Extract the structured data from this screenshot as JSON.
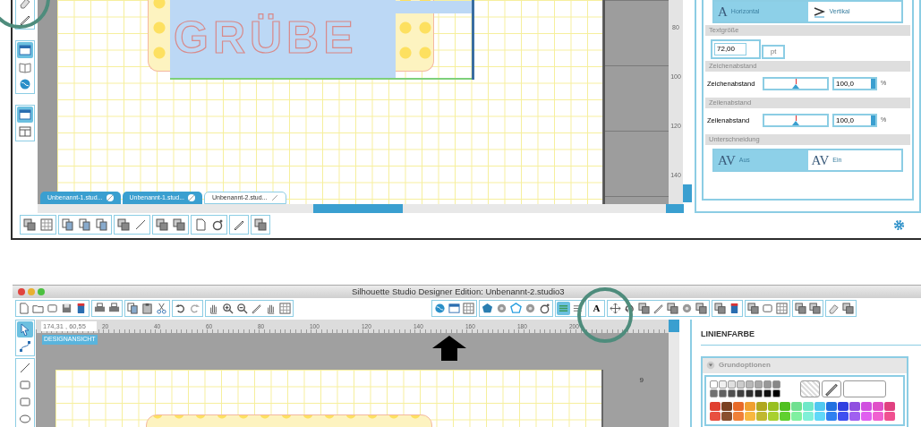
{
  "top_window": {
    "left_tools": [
      [
        {
          "selected": false
        },
        {
          "selected": false
        }
      ],
      [
        {
          "selected": true
        },
        {
          "selected": false
        },
        {
          "selected": false
        }
      ],
      [
        {
          "selected": true
        },
        {
          "selected": false
        }
      ]
    ],
    "canvas": {
      "design_text": "GRÜBE",
      "vertical_ruler": [
        "80",
        "100",
        "120",
        "140"
      ]
    },
    "document_tabs": [
      {
        "label": "Unbenannt-1.stud...",
        "selected": false
      },
      {
        "label": "Unbenannt-1.stud...",
        "selected": false
      },
      {
        "label": "Unbenannt-2.stud...",
        "selected": true
      }
    ],
    "text_panel": {
      "direction": [
        {
          "glyph": "A",
          "label": "Horizontal",
          "selected": true
        },
        {
          "label": "Vertikal",
          "selected": false
        }
      ],
      "text_size": {
        "heading": "Textgröße",
        "value": "72,00",
        "unit": "pt"
      },
      "spacing": [
        {
          "heading": "Zeichenabstand",
          "label": "Zeichenabstand",
          "level": 0.5,
          "value": "100,0",
          "unit": "%"
        },
        {
          "heading": "Zeilenabstand",
          "label": "Zeilenabstand",
          "level": 0.5,
          "value": "100,0",
          "unit": "%"
        }
      ],
      "kerning": {
        "heading": "Unterschneidung",
        "options": [
          {
            "glyph": "AV",
            "label": "Aus",
            "selected": true
          },
          {
            "glyph": "AV",
            "label": "Ein",
            "selected": false
          }
        ]
      }
    }
  },
  "bottom_window": {
    "title": "Silhouette Studio Designer Edition: Unbenannt-2.studio3",
    "toolbar": [
      {
        "kind": "icons",
        "items": [
          {
            "selected": false
          },
          {
            "selected": false
          },
          {
            "selected": false
          },
          {
            "selected": false
          },
          {
            "selected": false
          }
        ]
      },
      {
        "kind": "icons",
        "items": [
          {
            "selected": false
          },
          {
            "selected": false
          }
        ]
      },
      {
        "kind": "icons",
        "items": [
          {
            "selected": false
          },
          {
            "selected": false
          },
          {
            "selected": false
          }
        ]
      },
      {
        "kind": "icons",
        "items": [
          {
            "selected": false
          },
          {
            "selected": false
          }
        ]
      },
      {
        "kind": "icons",
        "items": [
          {
            "selected": false
          },
          {
            "selected": false
          },
          {
            "selected": false
          },
          {
            "selected": false
          },
          {
            "selected": false
          },
          {
            "selected": false
          }
        ]
      },
      {
        "kind": "spacer"
      },
      {
        "kind": "icons",
        "items": [
          {
            "selected": false
          },
          {
            "selected": false
          },
          {
            "selected": false
          }
        ]
      },
      {
        "kind": "icons",
        "items": [
          {
            "selected": false
          },
          {
            "selected": false
          },
          {
            "selected": false
          },
          {
            "selected": false
          },
          {
            "selected": false
          }
        ]
      },
      {
        "kind": "icons",
        "items": [
          {
            "selected": true
          },
          {
            "selected": false
          }
        ]
      },
      {
        "kind": "glyph",
        "glyph": "A",
        "selected": false
      },
      {
        "kind": "icons",
        "items": [
          {
            "selected": false
          },
          {
            "selected": false
          },
          {
            "selected": false
          },
          {
            "selected": false
          },
          {
            "selected": false
          },
          {
            "selected": false
          },
          {
            "selected": false
          }
        ]
      },
      {
        "kind": "icons",
        "items": [
          {
            "selected": false
          },
          {
            "selected": false
          }
        ]
      },
      {
        "kind": "icons",
        "items": [
          {
            "selected": false
          },
          {
            "selected": false
          },
          {
            "selected": false
          }
        ]
      },
      {
        "kind": "icons",
        "items": [
          {
            "selected": false
          },
          {
            "selected": false
          }
        ]
      },
      {
        "kind": "icons",
        "items": [
          {
            "selected": false
          },
          {
            "selected": false
          }
        ]
      }
    ],
    "left_tools": [
      [
        {
          "selected": true
        },
        {
          "selected": false
        }
      ],
      [
        {
          "selected": false
        },
        {
          "selected": false
        },
        {
          "selected": false
        },
        {
          "selected": false
        }
      ]
    ],
    "ruler": {
      "coordinates": "174,31 , 60,55",
      "labels": [
        "20",
        "40",
        "60",
        "80",
        "100",
        "120",
        "140",
        "160",
        "180",
        "200"
      ]
    },
    "view_label": "DESIGNANSICHT",
    "vertical_ruler": [
      "9"
    ],
    "line_color_panel": {
      "title": "LINIENFARBE",
      "section": "Grundoptionen",
      "swatches": [
        [
          {
            "color": "#ffffff"
          },
          {
            "color": "#f0f0f0"
          },
          {
            "color": "#e0e0e0"
          },
          {
            "color": "#cccccc"
          },
          {
            "color": "#b8b8b8"
          },
          {
            "color": "#a8a8a8"
          },
          {
            "color": "#989898"
          },
          {
            "color": "#888888"
          }
        ],
        [
          {
            "color": "#707070"
          },
          {
            "color": "#606060"
          },
          {
            "color": "#505050"
          },
          {
            "color": "#404040"
          },
          {
            "color": "#303030"
          },
          {
            "color": "#202020"
          },
          {
            "color": "#101010"
          },
          {
            "color": "#000000"
          }
        ],
        [
          {
            "color": "#e04030"
          },
          {
            "color": "#7a4020"
          },
          {
            "color": "#e86a28"
          },
          {
            "color": "#f0a030"
          },
          {
            "color": "#b0a820"
          },
          {
            "color": "#98c020"
          },
          {
            "color": "#50c020"
          },
          {
            "color": "#70e090"
          },
          {
            "color": "#70e8c8"
          },
          {
            "color": "#50c8f0"
          },
          {
            "color": "#2070e0"
          },
          {
            "color": "#3040e0"
          },
          {
            "color": "#9050e0"
          },
          {
            "color": "#d050e0"
          },
          {
            "color": "#e050c8"
          },
          {
            "color": "#e04080"
          }
        ],
        [
          {
            "color": "#e85040"
          },
          {
            "color": "#8a5030"
          },
          {
            "color": "#f08038"
          },
          {
            "color": "#f8b840"
          },
          {
            "color": "#c0b830"
          },
          {
            "color": "#a8d030"
          },
          {
            "color": "#60d030"
          },
          {
            "color": "#80f0a0"
          },
          {
            "color": "#80f0d8"
          },
          {
            "color": "#60d8f8"
          },
          {
            "color": "#3080f0"
          },
          {
            "color": "#4050f0"
          },
          {
            "color": "#a060f0"
          },
          {
            "color": "#e060f0"
          },
          {
            "color": "#f060d0"
          },
          {
            "color": "#f05090"
          }
        ]
      ]
    }
  }
}
